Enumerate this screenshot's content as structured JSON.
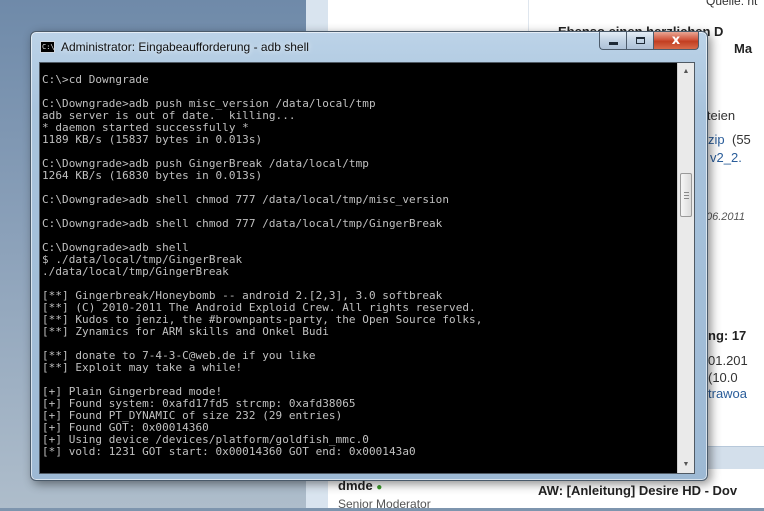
{
  "background_page": {
    "top_right_fragment": "Quelle: ht",
    "heading_fragment": "Ebenso einen herzlichen D",
    "heading_fragment_2": "Ma",
    "files_fragment": "iteien",
    "file_link_1": "zip",
    "file_size_1": "(55",
    "file_link_2": "v2_2.",
    "date_fragment": "06.2011",
    "stat_fragment": "ng: 17",
    "date_fragment_2": "01.201",
    "paren_fragment": "(10.0",
    "link_fragment": "trawoa",
    "username_fragment": "dmde",
    "user_role": "Senior Moderator",
    "thread_title": "AW: [Anleitung] Desire HD - Dov"
  },
  "window": {
    "title": "Administrator: Eingabeaufforderung - adb  shell",
    "icon_text": "C:\\",
    "minimize_label": "minimize",
    "maximize_label": "maximize",
    "close_label": "x"
  },
  "console": {
    "lines": [
      "C:\\>cd Downgrade",
      "",
      "C:\\Downgrade>adb push misc_version /data/local/tmp",
      "adb server is out of date.  killing...",
      "* daemon started successfully *",
      "1189 KB/s (15837 bytes in 0.013s)",
      "",
      "C:\\Downgrade>adb push GingerBreak /data/local/tmp",
      "1264 KB/s (16830 bytes in 0.013s)",
      "",
      "C:\\Downgrade>adb shell chmod 777 /data/local/tmp/misc_version",
      "",
      "C:\\Downgrade>adb shell chmod 777 /data/local/tmp/GingerBreak",
      "",
      "C:\\Downgrade>adb shell",
      "$ ./data/local/tmp/GingerBreak",
      "./data/local/tmp/GingerBreak",
      "",
      "[**] Gingerbreak/Honeybomb -- android 2.[2,3], 3.0 softbreak",
      "[**] (C) 2010-2011 The Android Exploid Crew. All rights reserved.",
      "[**] Kudos to jenzi, the #brownpants-party, the Open Source folks,",
      "[**] Zynamics for ARM skills and Onkel Budi",
      "",
      "[**] donate to 7-4-3-C@web.de if you like",
      "[**] Exploit may take a while!",
      "",
      "[+] Plain Gingerbread mode!",
      "[+] Found system: 0xafd17fd5 strcmp: 0xafd38065",
      "[+] Found PT_DYNAMIC of size 232 (29 entries)",
      "[+] Found GOT: 0x00014360",
      "[+] Using device /devices/platform/goldfish_mmc.0",
      "[*] vold: 1231 GOT start: 0x00014360 GOT end: 0x000143a0"
    ]
  },
  "scrollbar": {
    "up_icon": "▲",
    "down_icon": "▼"
  }
}
